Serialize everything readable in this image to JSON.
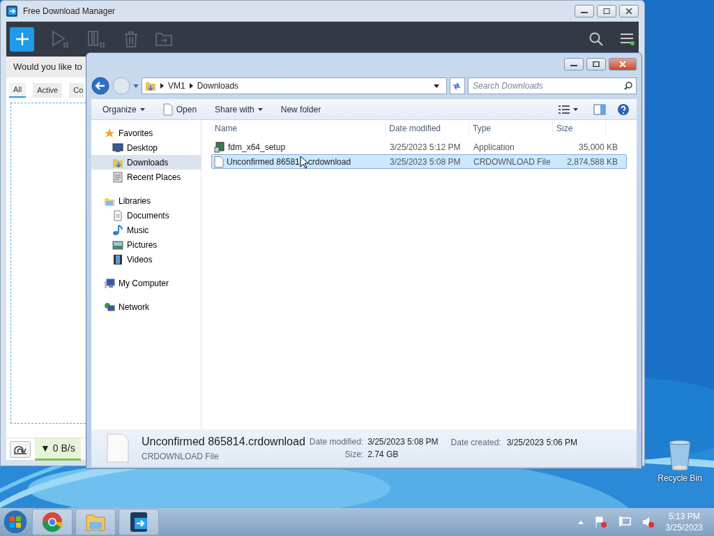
{
  "fdm_window": {
    "title": "Free Download Manager",
    "banner": "Would you like to",
    "tabs": [
      {
        "label": "All",
        "selected": true
      },
      {
        "label": "Active",
        "selected": false
      },
      {
        "label": "Co",
        "selected": false
      }
    ],
    "speed": "▼ 0 B/s"
  },
  "explorer": {
    "breadcrumb": [
      "VM1",
      "Downloads"
    ],
    "search": {
      "placeholder": "Search Downloads"
    },
    "toolbar": [
      {
        "label": "Organize",
        "kind": "menu"
      },
      {
        "label": "Open",
        "kind": "file"
      },
      {
        "label": "Share with",
        "kind": "menu"
      },
      {
        "label": "New folder",
        "kind": "plain"
      }
    ],
    "sidebar": [
      {
        "label": "Favorites",
        "kind": "star",
        "selected": false,
        "children": [
          {
            "label": "Desktop",
            "kind": "desktop",
            "selected": false
          },
          {
            "label": "Downloads",
            "kind": "folder",
            "selected": true
          },
          {
            "label": "Recent Places",
            "kind": "recent",
            "selected": false
          }
        ]
      },
      {
        "label": "Libraries",
        "kind": "library",
        "selected": false,
        "children": [
          {
            "label": "Documents",
            "kind": "document",
            "selected": false
          },
          {
            "label": "Music",
            "kind": "music",
            "selected": false
          },
          {
            "label": "Pictures",
            "kind": "picture",
            "selected": false
          },
          {
            "label": "Videos",
            "kind": "video",
            "selected": false
          }
        ]
      },
      {
        "label": "My Computer",
        "kind": "computer",
        "selected": false
      },
      {
        "label": "Network",
        "kind": "network",
        "selected": false
      }
    ],
    "columns": [
      "Name",
      "Date modified",
      "Type",
      "Size"
    ],
    "rows": [
      {
        "kind": "app",
        "name_parts": [
          "fdm_x64_setup"
        ],
        "date": "3/25/2023 5:12 PM",
        "type": "Application",
        "size": "35,000 KB",
        "selected": false
      },
      {
        "kind": "file",
        "name_parts": [
          "Unconfirmed 86581",
          "crdownload"
        ],
        "date": "3/25/2023 5:08 PM",
        "type": "CRDOWNLOAD File",
        "size": "2,874,588 KB",
        "selected": true
      }
    ],
    "details": {
      "name": "Unconfirmed 865814.crdownload",
      "type": "CRDOWNLOAD File",
      "modified_label": "Date modified:",
      "modified": "3/25/2023 5:08 PM",
      "size_label": "Size:",
      "size": "2.74 GB",
      "created_label": "Date created:",
      "created": "3/25/2023 5:06 PM"
    }
  },
  "desktop_icons": [
    {
      "label": "Recycle Bin"
    }
  ],
  "taskbar": {
    "apps": [
      {
        "kind": "chrome"
      },
      {
        "kind": "explorer"
      },
      {
        "kind": "fdm"
      }
    ],
    "clock": {
      "time": "5:13 PM",
      "date": "3/25/2023"
    }
  }
}
